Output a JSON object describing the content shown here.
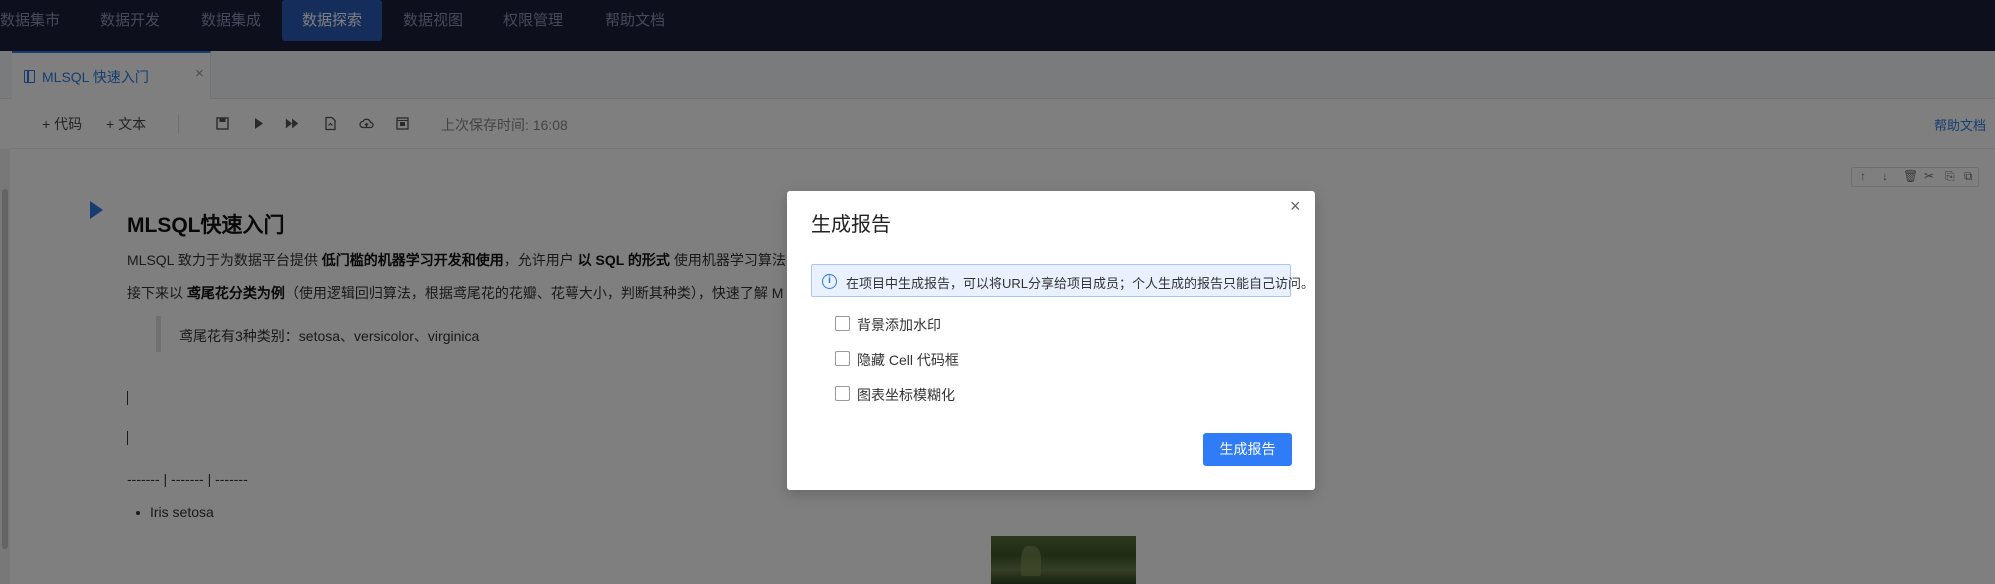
{
  "nav": {
    "items": [
      {
        "label": "数据集市",
        "active": false
      },
      {
        "label": "数据开发",
        "active": false
      },
      {
        "label": "数据集成",
        "active": false
      },
      {
        "label": "数据探索",
        "active": true
      },
      {
        "label": "数据视图",
        "active": false
      },
      {
        "label": "权限管理",
        "active": false
      },
      {
        "label": "帮助文档",
        "active": false
      }
    ]
  },
  "tab": {
    "label": "MLSQL 快速入门",
    "close": "×"
  },
  "toolbar": {
    "add_code": "+ 代码",
    "add_text": "+ 文本",
    "save_time": "上次保存时间: 16:08",
    "help": "帮助文档"
  },
  "cell_toolbar": [
    "↑",
    "↓",
    "🗑",
    "✂",
    "⎘",
    "⧉"
  ],
  "doc": {
    "title": "MLSQL快速入门",
    "p1_a": "MLSQL 致力于为数据平台提供 ",
    "p1_b": "低门槛的机器学习开发和使用",
    "p1_c": "，允许用户 ",
    "p1_d": "以 SQL 的形式",
    "p1_e": " 使用机器学习算法",
    "p2_a": "接下来以 ",
    "p2_b": "鸢尾花分类为例",
    "p2_c": "（使用逻辑回归算法，根据鸢尾花的花瓣、花萼大小，判断其种类），快速了解 M",
    "quote": "鸢尾花有3种类别：setosa、versicolor、virginica",
    "dashes": "------- | ------- | -------",
    "bullet": "Iris setosa"
  },
  "modal": {
    "title": "生成报告",
    "close": "×",
    "info_icon": "i",
    "info_text": "在项目中生成报告，可以将URL分享给项目成员；个人生成的报告只能自己访问。",
    "options": [
      {
        "label": "背景添加水印",
        "checked": false
      },
      {
        "label": "隐藏 Cell 代码框",
        "checked": false
      },
      {
        "label": "图表坐标模糊化",
        "checked": false
      }
    ],
    "submit": "生成报告"
  },
  "colors": {
    "accent": "#2f7cf6",
    "nav_bg": "#1b1e3b",
    "nav_active": "#2b5ab6"
  }
}
